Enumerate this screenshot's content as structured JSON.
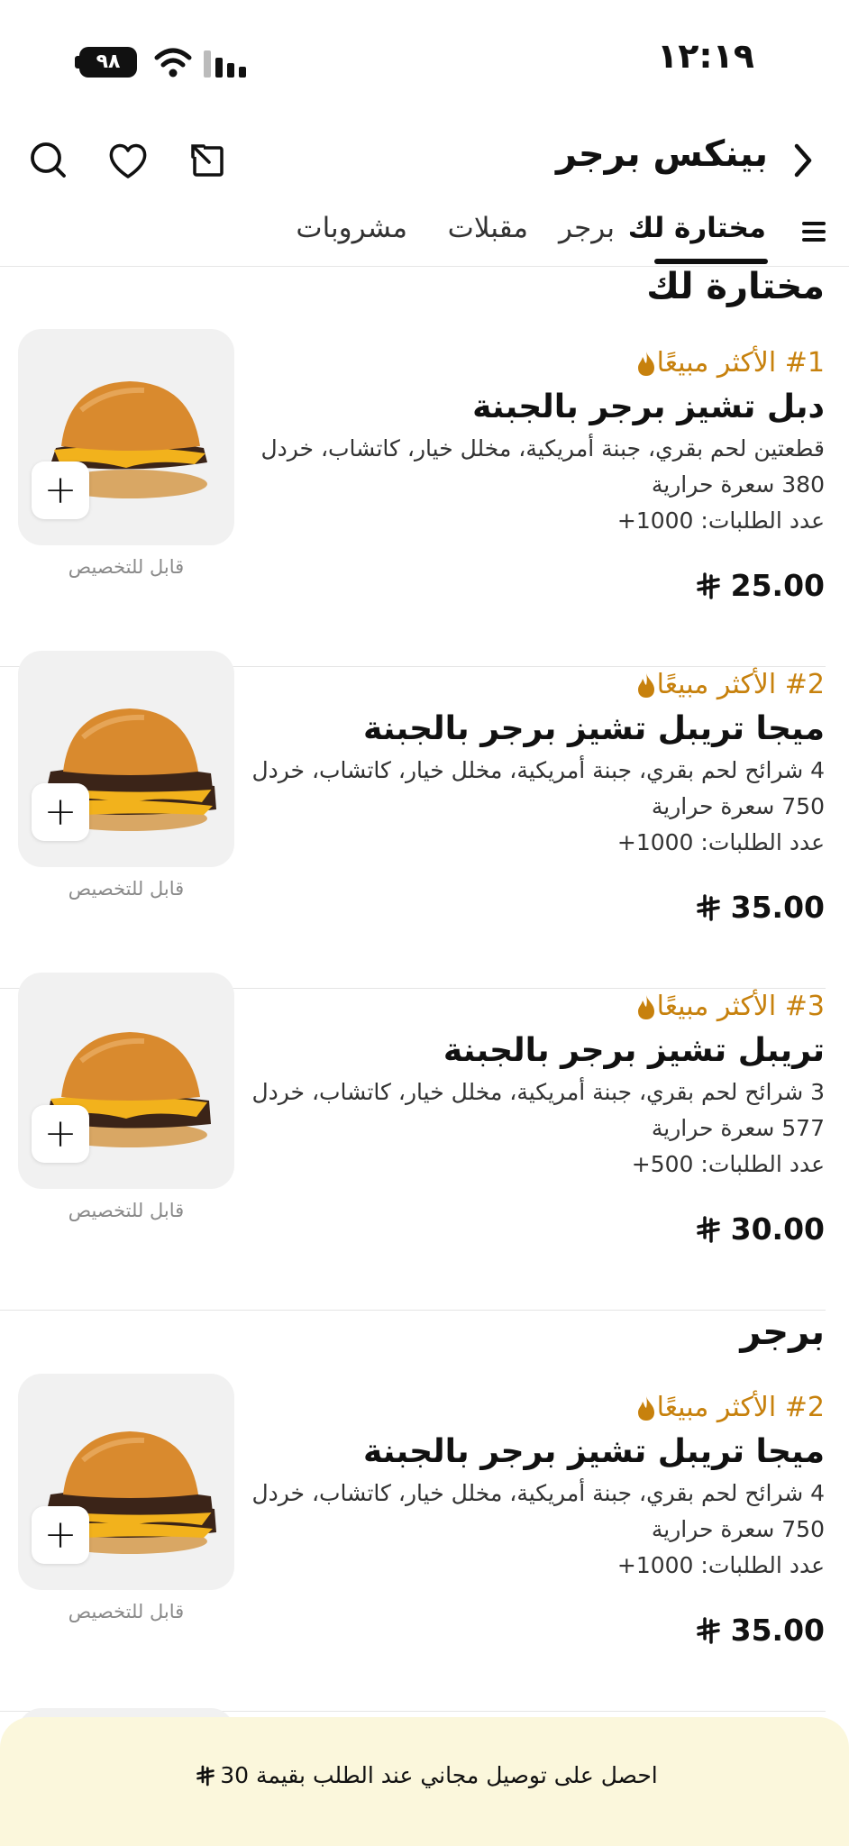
{
  "status_bar": {
    "time": "١٢:١٩",
    "battery": "٩٨"
  },
  "header": {
    "title": "بينكس برجر",
    "icons": [
      "chevron-right-icon",
      "share-icon",
      "heart-icon",
      "search-icon"
    ]
  },
  "tabs": [
    {
      "label": "مختارة لك",
      "active": true
    },
    {
      "label": "برجر",
      "active": false
    },
    {
      "label": "مقبلات",
      "active": false
    },
    {
      "label": "مشروبات",
      "active": false
    }
  ],
  "sections": {
    "featured": "مختارة لك",
    "burger": "برجر"
  },
  "items": [
    {
      "badge": "#1 الأكثر مبيعًا",
      "name": "دبل تشيز برجر بالجبنة",
      "description": "قطعتين لحم بقري، جبنة أمريكية، مخلل خيار، كاتشاب، خردل",
      "calories": "380 سعرة حرارية",
      "orders": "عدد الطلبات: 1000+",
      "price": "25.00",
      "customizable": "قابل للتخصيص"
    },
    {
      "badge": "#2 الأكثر مبيعًا",
      "name": "ميجا تريبل تشيز برجر بالجبنة",
      "description": "4 شرائح لحم بقري، جبنة أمريكية، مخلل خيار، كاتشاب، خردل",
      "calories": "750 سعرة حرارية",
      "orders": "عدد الطلبات: 1000+",
      "price": "35.00",
      "customizable": "قابل للتخصيص"
    },
    {
      "badge": "#3 الأكثر مبيعًا",
      "name": "تريبل تشيز برجر بالجبنة",
      "description": "3 شرائح لحم بقري، جبنة أمريكية، مخلل خيار، كاتشاب، خردل",
      "calories": "577 سعرة حرارية",
      "orders": "عدد الطلبات: 500+",
      "price": "30.00",
      "customizable": "قابل للتخصيص"
    },
    {
      "badge": "#2 الأكثر مبيعًا",
      "name": "ميجا تريبل تشيز برجر بالجبنة",
      "description": "4 شرائح لحم بقري، جبنة أمريكية، مخلل خيار، كاتشاب، خردل",
      "calories": "750 سعرة حرارية",
      "orders": "عدد الطلبات: 1000+",
      "price": "35.00",
      "customizable": "قابل للتخصيص"
    }
  ],
  "promo": {
    "text_before": "احصل على توصيل مجاني عند الطلب بقيمة 30"
  },
  "colors": {
    "accent": "#c7810d",
    "promo_bg": "#fbf7dc",
    "text": "#111111"
  }
}
